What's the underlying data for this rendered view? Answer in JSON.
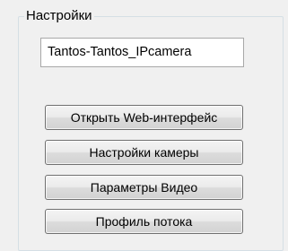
{
  "group": {
    "title": "Настройки"
  },
  "device_name": {
    "value": "Tantos-Tantos_IPcamera"
  },
  "buttons": {
    "open_web": "Открыть Web-интерфейс",
    "camera_settings": "Настройки камеры",
    "video_params": "Параметры Видео",
    "stream_profile": "Профиль потока"
  }
}
